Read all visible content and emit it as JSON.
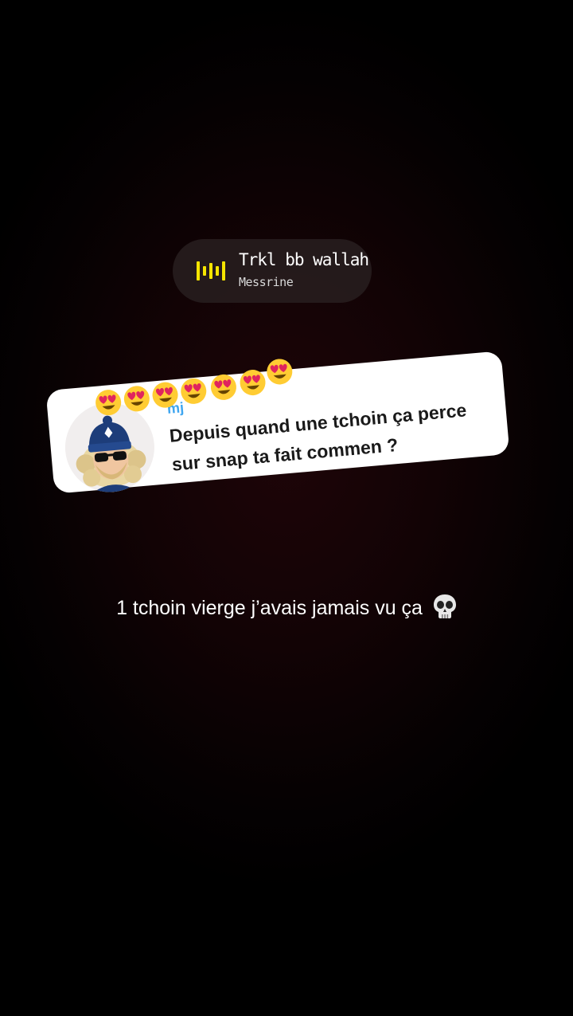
{
  "music_sticker": {
    "title": "Trkl bb wallah",
    "artist": "Messrine",
    "icon": "audio-bars-icon",
    "icon_color": "#f5e400"
  },
  "question_card": {
    "username": "mj",
    "question": "Depuis quand une tchoin ça perce sur snap ta fait commen ?",
    "avatar_icon": "bitmoji-avatar-icon",
    "decoration_emoji": "😍",
    "decoration_count": 7
  },
  "caption": {
    "text": "1 tchoin vierge j’avais jamais vu ça",
    "emoji": "💀"
  },
  "colors": {
    "background": "#000000",
    "card": "#ffffff",
    "username": "#3fa6f0"
  }
}
